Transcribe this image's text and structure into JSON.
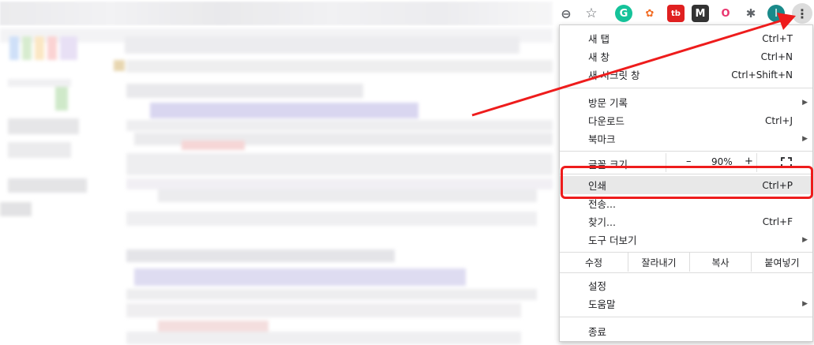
{
  "toolbar": {
    "icons": [
      {
        "name": "zoom-out-icon",
        "glyph": "⊖",
        "color": "#5f6368"
      },
      {
        "name": "bookmark-star-icon",
        "glyph": "☆",
        "color": "#5f6368"
      },
      {
        "name": "grammarly-extension-icon",
        "glyph": "G",
        "color": "#15c39a"
      },
      {
        "name": "honey-extension-icon",
        "glyph": "✿",
        "color": "#f26c23"
      },
      {
        "name": "tb-extension-icon",
        "glyph": "tb",
        "color": "#e02020"
      },
      {
        "name": "mail-extension-icon",
        "glyph": "M",
        "color": "#333333"
      },
      {
        "name": "color-ring-extension-icon",
        "glyph": "O",
        "color": "#f0a020"
      },
      {
        "name": "puzzle-extensions-icon",
        "glyph": "✱",
        "color": "#5f6368"
      },
      {
        "name": "profile-avatar-icon",
        "glyph": "I",
        "color": "#1a8a8a"
      }
    ],
    "menu_glyph": "⋮"
  },
  "menu": {
    "items_top": [
      {
        "label": "새 탭",
        "shortcut": "Ctrl+T"
      },
      {
        "label": "새 창",
        "shortcut": "Ctrl+N"
      },
      {
        "label": "새 시크릿 창",
        "shortcut": "Ctrl+Shift+N"
      }
    ],
    "items_mid": [
      {
        "label": "방문 기록",
        "shortcut": "",
        "arrow": "▶"
      },
      {
        "label": "다운로드",
        "shortcut": "Ctrl+J",
        "arrow": ""
      },
      {
        "label": "북마크",
        "shortcut": "",
        "arrow": "▶"
      }
    ],
    "zoom": {
      "label": "글꼴 크기",
      "minus": "–",
      "value": "90%",
      "plus": "+"
    },
    "items_tools": [
      {
        "label": "인쇄",
        "shortcut": "Ctrl+P",
        "arrow": ""
      },
      {
        "label": "전송...",
        "shortcut": "",
        "arrow": ""
      },
      {
        "label": "찾기...",
        "shortcut": "Ctrl+F",
        "arrow": ""
      },
      {
        "label": "도구 더보기",
        "shortcut": "",
        "arrow": "▶"
      }
    ],
    "edit": {
      "label": "수정",
      "cut": "잘라내기",
      "copy": "복사",
      "paste": "붙여넣기"
    },
    "items_settings": [
      {
        "label": "설정",
        "arrow": ""
      },
      {
        "label": "도움말",
        "arrow": "▶"
      }
    ],
    "exit": "종료"
  },
  "colors": {
    "annotation": "#ee1c1c",
    "highlight": "#e8e8e8"
  }
}
